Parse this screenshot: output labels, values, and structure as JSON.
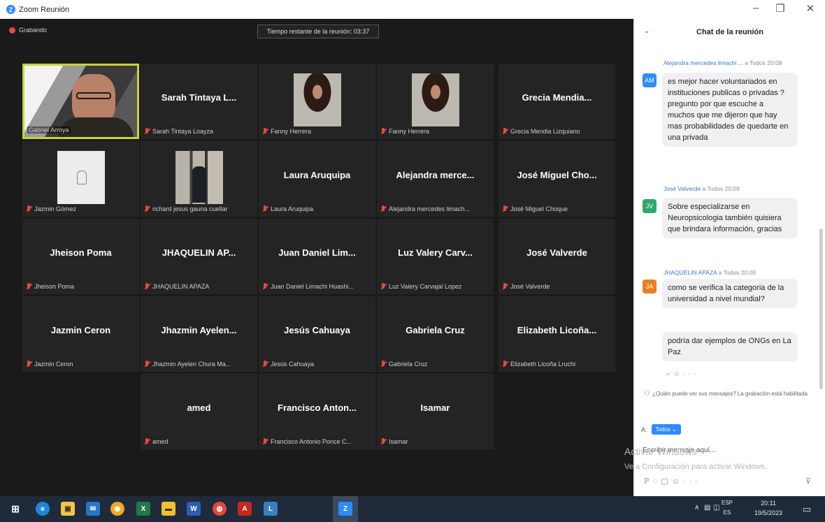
{
  "window": {
    "title": "Zoom Reunión",
    "logo": "zoom-logo",
    "minimize": "–",
    "maximize": "❐",
    "close": "✕"
  },
  "meeting": {
    "recording_label": "Grabando",
    "time_remaining": "Tiempo restante de la reunión: 03:37"
  },
  "tiles": [
    {
      "display": "",
      "footer": "Gabriel Arroya",
      "type": "speaker"
    },
    {
      "display": "Sarah Tintaya L...",
      "footer": "Sarah Tintaya Loayza",
      "type": "name"
    },
    {
      "display": "",
      "footer": "Fanny Herrera",
      "type": "woman"
    },
    {
      "display": "",
      "footer": "Fanny Herrera",
      "type": "woman"
    },
    {
      "display": "Grecia Mendia...",
      "footer": "Grecia Mendia Lizquiano",
      "type": "name"
    },
    {
      "display": "",
      "footer": "Jazmin Gómez",
      "type": "sketch"
    },
    {
      "display": "",
      "footer": "richard jesus gauna cuellar",
      "type": "person"
    },
    {
      "display": "Laura Aruquipa",
      "footer": "Laura Aruquipa",
      "type": "name"
    },
    {
      "display": "Alejandra merce...",
      "footer": "Alejandra mercedes limach...",
      "type": "name"
    },
    {
      "display": "José Miguel Cho...",
      "footer": "José Miguel Choque",
      "type": "name"
    },
    {
      "display": "Jheison Poma",
      "footer": "Jheison Poma",
      "type": "name"
    },
    {
      "display": "JHAQUELIN AP...",
      "footer": "JHAQUELIN APAZA",
      "type": "name"
    },
    {
      "display": "Juan Daniel Lim...",
      "footer": "Juan Daniel Limachi Huashi...",
      "type": "name"
    },
    {
      "display": "Luz Valery Carv...",
      "footer": "Luz Valery Carvajal Lopez",
      "type": "name"
    },
    {
      "display": "José Valverde",
      "footer": "José Valverde",
      "type": "name"
    },
    {
      "display": "Jazmin Ceron",
      "footer": "Jazmin Ceron",
      "type": "name"
    },
    {
      "display": "Jhazmin Ayelen...",
      "footer": "Jhazmin Ayelen Chura Ma...",
      "type": "name"
    },
    {
      "display": "Jesús Cahuaya",
      "footer": "Jesús Cahuaya",
      "type": "name"
    },
    {
      "display": "Gabriela Cruz",
      "footer": "Gabriela Cruz",
      "type": "name"
    },
    {
      "display": "Elizabeth Licoña...",
      "footer": "Elizabeth Licoña Lruchi",
      "type": "name"
    },
    {
      "display": "amed",
      "footer": "amed",
      "type": "name"
    },
    {
      "display": "Francisco Anton...",
      "footer": "Francisco Antonio Ponce C...",
      "type": "name"
    },
    {
      "display": "Isamar",
      "footer": "Isamar",
      "type": "name"
    }
  ],
  "chat": {
    "title": "Chat de la reunión",
    "collapse_icon": "chevron-down-icon",
    "messages": [
      {
        "sender": "Alejandra mercedes limachi ...",
        "to": "a Todos",
        "time": "20:08",
        "initials": "AM",
        "avatar_color": "#2d8cff",
        "bubbles": [
          "es mejor hacer voluntariados en instituciones publicas o privadas ? pregunto por que escuche a muchos que me dijeron que hay mas probabilidades de quedarte en una privada"
        ]
      },
      {
        "sender": "José Valverde",
        "to": "a Todos",
        "time": "20:09",
        "initials": "JV",
        "avatar_color": "#2fa86a",
        "bubbles": [
          "Sobre especializarse en Neuropsicologia también quisiera que brindara información, gracias"
        ]
      },
      {
        "sender": "JHAQUELIN APAZA",
        "to": "a Todos",
        "time": "20:09",
        "initials": "JA",
        "avatar_color": "#e8801f",
        "bubbles": [
          "como se verifica la categoria de la universidad a nivel mundial?",
          "podría dar ejemplos de ONGs en La Paz"
        ]
      }
    ],
    "privacy_notice": "¿Quién puede ver sus mensajes? La grabación está habilitada",
    "to_label": "A:",
    "to_button": "Todos ⌄",
    "input_placeholder": "Escribir mensaje aquí...",
    "watermark_line1": "Activar Windows",
    "watermark_line2": "Ve a Configuración para activar Windows.",
    "more": "···"
  },
  "taskbar": {
    "lang_top": "ESP",
    "lang_bottom": "ES",
    "time": "20:11",
    "date": "19/5/2023"
  }
}
